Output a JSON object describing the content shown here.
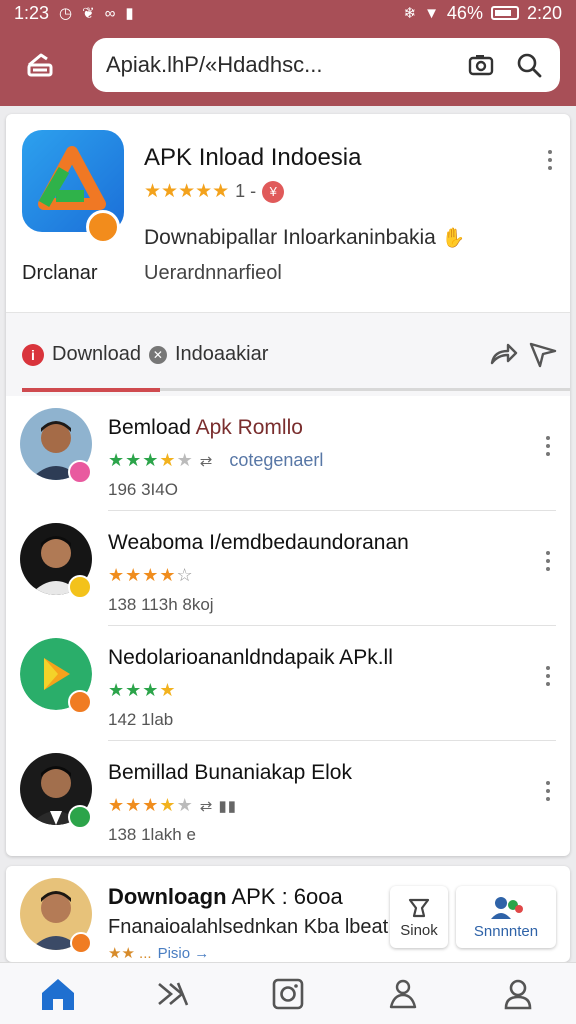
{
  "status": {
    "time": "1:23",
    "battery": "46%",
    "clock_right": "2:20"
  },
  "search": {
    "query": "Apiak.lhP/«Hdadhsc..."
  },
  "app": {
    "title": "APK Inload Indoesia",
    "rating_text": "1 -",
    "rating_badge": "¥",
    "description": "Downabipallar Inloarkaninbakia",
    "developer": "Drclanar",
    "subtitle": "Uerardnnarfieol",
    "icon_color": "#2b8ee8",
    "badge_color": "#f28c1c"
  },
  "tabs": {
    "download_label": "Download",
    "second_label": "Indoaakiar",
    "active_color": "#cf4a4f"
  },
  "list": [
    {
      "title_a": "Bemload ",
      "title_b": "Apk Romllo",
      "stars": "★★★★★",
      "category": "cotegenaerl",
      "size": "196 3I4O",
      "star_color": "#2ca44a"
    },
    {
      "title_a": "Weaboma I/emdbedaundoranan",
      "title_b": "",
      "stars": "★★★★☆",
      "category": "",
      "size": "138 113h 8koj",
      "star_color": "#f08d1e"
    },
    {
      "title_a": "Nedolarioananldndapaik APk.ll",
      "title_b": "",
      "stars": "★★★★",
      "category": "",
      "size": "142 1lab",
      "star_color": "#2ca44a"
    },
    {
      "title_a": "Bemillad Bunaniakap Elok",
      "title_b": "",
      "stars": "★★★★★",
      "category": "",
      "size": "138 1lakh e",
      "star_color": "#f08d1e"
    }
  ],
  "bottom_card": {
    "title_bold": "Downloagn",
    "title_rest": " APK : 6ooa",
    "subtitle": "Fnanaioalahlsednkan Kba lbeat",
    "tag_a": "★★ ...",
    "tag_b": "Pisio →",
    "chip_stock": "Sinok",
    "chip_sub": "Snnnnten"
  },
  "nav": [
    "home-icon",
    "shuffle-icon",
    "instagram-icon",
    "user-pin-icon",
    "profile-icon"
  ]
}
